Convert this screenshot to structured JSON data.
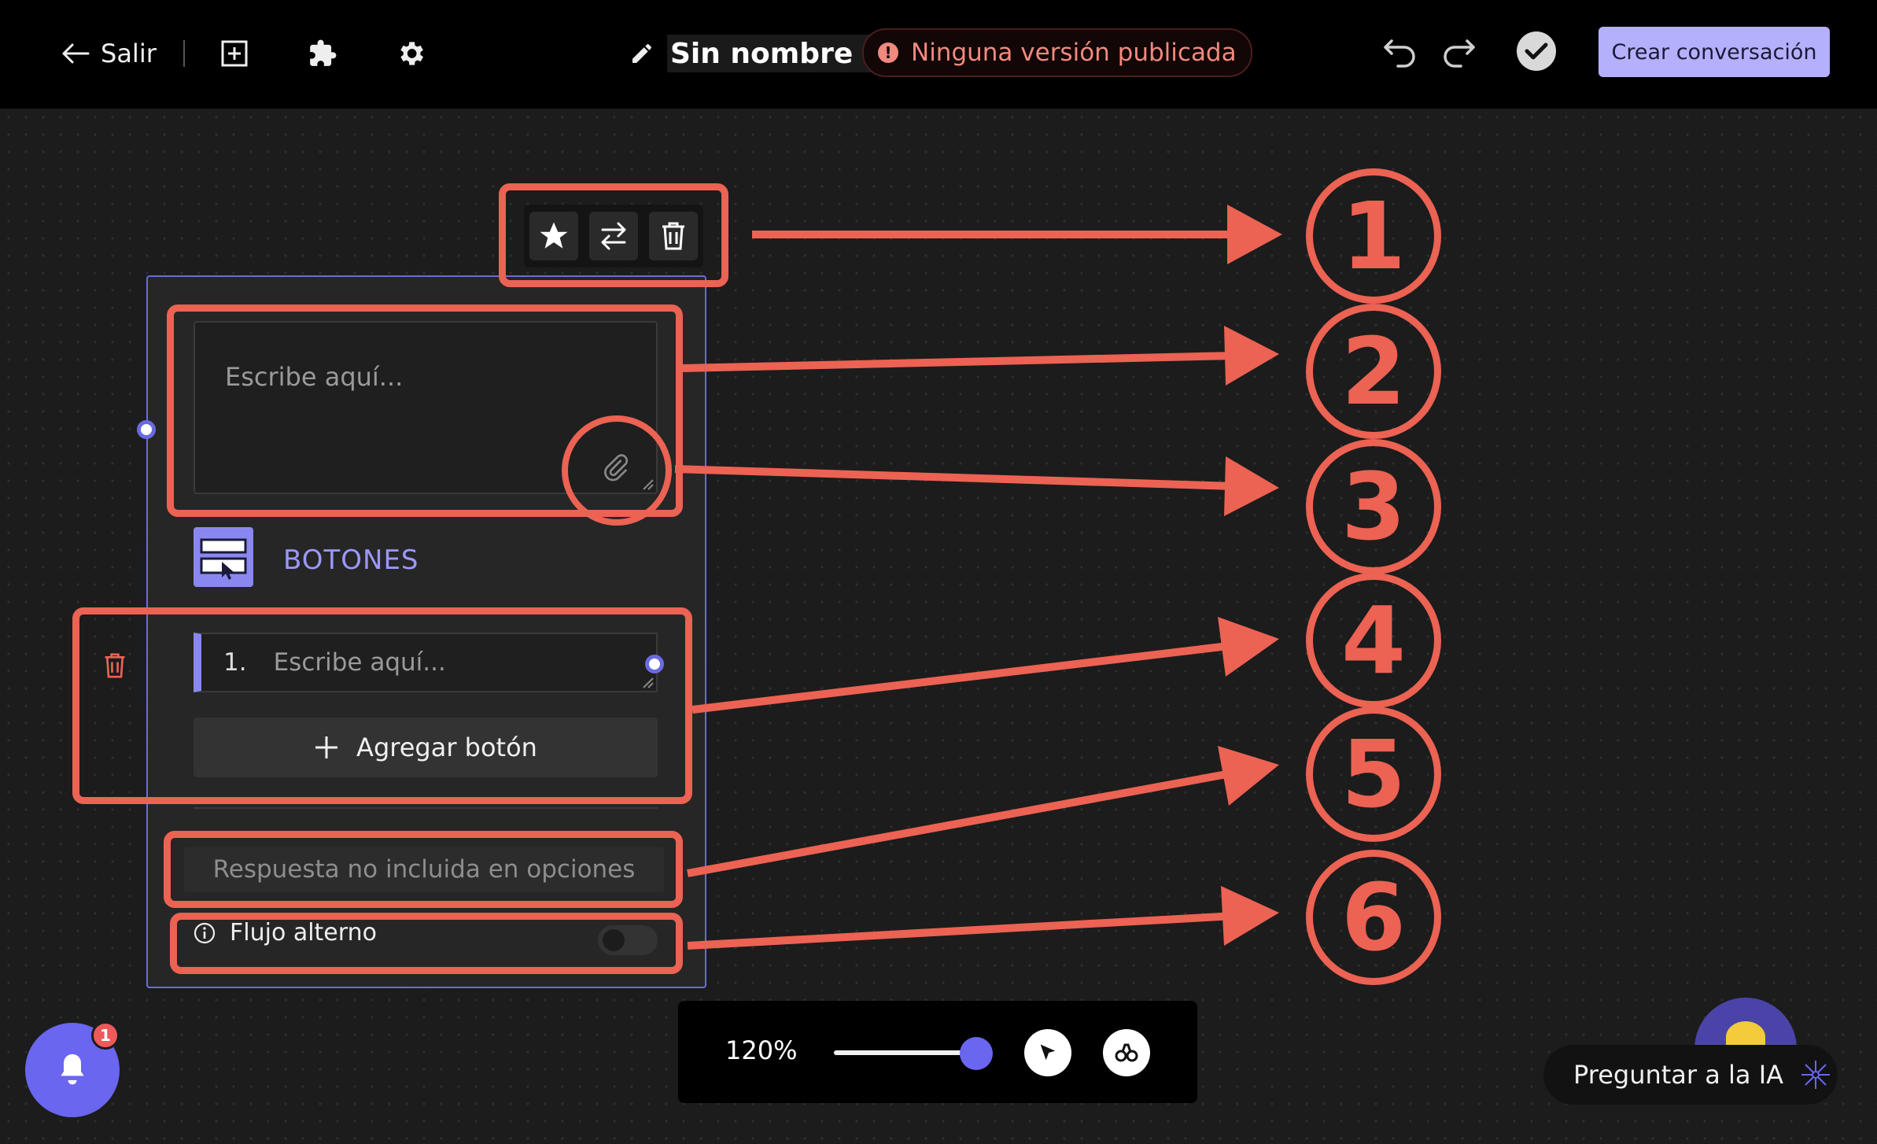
{
  "topbar": {
    "exit_label": "Salir",
    "title": "Sin nombre",
    "status": "Ninguna versión publicada",
    "status_icon": "!",
    "create_label": "Crear conversación"
  },
  "node": {
    "message_placeholder": "Escribe aquí...",
    "section_label": "BOTONES",
    "button_number": "1.",
    "button_placeholder": "Escribe aquí...",
    "add_button_label": "Agregar botón",
    "no_option_label": "Respuesta no incluida en opciones",
    "alt_flow_label": "Flujo alterno",
    "alt_flow_enabled": false
  },
  "annotations": [
    "1",
    "2",
    "3",
    "4",
    "5",
    "6"
  ],
  "zoom": {
    "value": "120%"
  },
  "notifications": {
    "count": "1"
  },
  "ai": {
    "label": "Preguntar a la IA"
  },
  "colors": {
    "accent": "#6a66f0",
    "annotation": "#ec6253",
    "create_button": "#b4b0fb",
    "status_text": "#f08a7e",
    "section_label": "#9c98ff"
  }
}
